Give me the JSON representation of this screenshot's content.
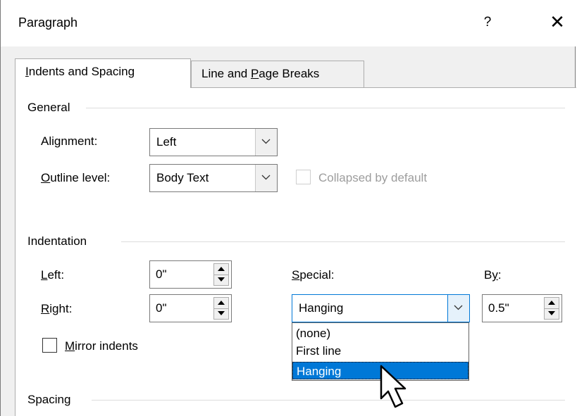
{
  "window": {
    "title": "Paragraph",
    "help_label": "?",
    "close_label": "✕"
  },
  "tabs": [
    {
      "pre": "",
      "u": "I",
      "post": "ndents and Spacing"
    },
    {
      "pre": "Line and ",
      "u": "P",
      "post": "age Breaks"
    }
  ],
  "general": {
    "section_label": "General",
    "alignment": {
      "pre": "Ali",
      "u": "g",
      "post": "nment:",
      "value": "Left"
    },
    "outline_level": {
      "pre": "",
      "u": "O",
      "post": "utline level:",
      "value": "Body Text"
    },
    "collapsed_label": "Collapsed by default"
  },
  "indentation": {
    "section_label": "Indentation",
    "left": {
      "pre": "",
      "u": "L",
      "post": "eft:",
      "value": "0\""
    },
    "right": {
      "pre": "",
      "u": "R",
      "post": "ight:",
      "value": "0\""
    },
    "special": {
      "pre": "",
      "u": "S",
      "post": "pecial:",
      "value": "Hanging"
    },
    "by": {
      "pre": "B",
      "u": "y",
      "post": ":",
      "value": "0.5\""
    },
    "mirror": {
      "pre": "",
      "u": "M",
      "post": "irror indents",
      "checked": false
    },
    "special_options": [
      "(none)",
      "First line",
      "Hanging"
    ],
    "selected_option": "Hanging"
  },
  "spacing": {
    "section_label": "Spacing"
  },
  "colors": {
    "accent": "#0078d7",
    "dialog_bg": "#f0f0f0",
    "panel_bg": "#ffffff"
  }
}
